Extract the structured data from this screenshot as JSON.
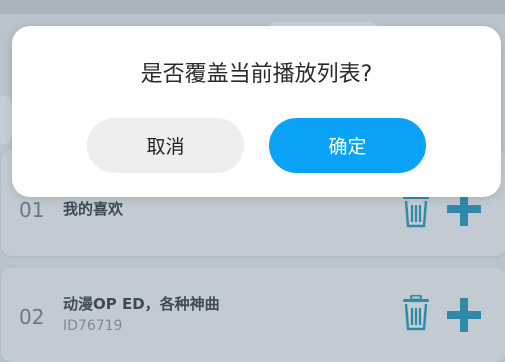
{
  "dialog": {
    "message": "是否覆盖当前播放列表?",
    "cancel_label": "取消",
    "confirm_label": "确定"
  },
  "playlists": [
    {
      "index": "01",
      "title": "我的喜欢",
      "subtitle": ""
    },
    {
      "index": "02",
      "title": "动漫OP ED，各种神曲",
      "subtitle": "ID76719"
    }
  ],
  "icons": {
    "delete": "trash-icon",
    "add": "plus-icon"
  },
  "colors": {
    "accent": "#0aa3f7",
    "icon_teal": "#2f8aa8",
    "overlay_bg": "#b9c3cb"
  }
}
